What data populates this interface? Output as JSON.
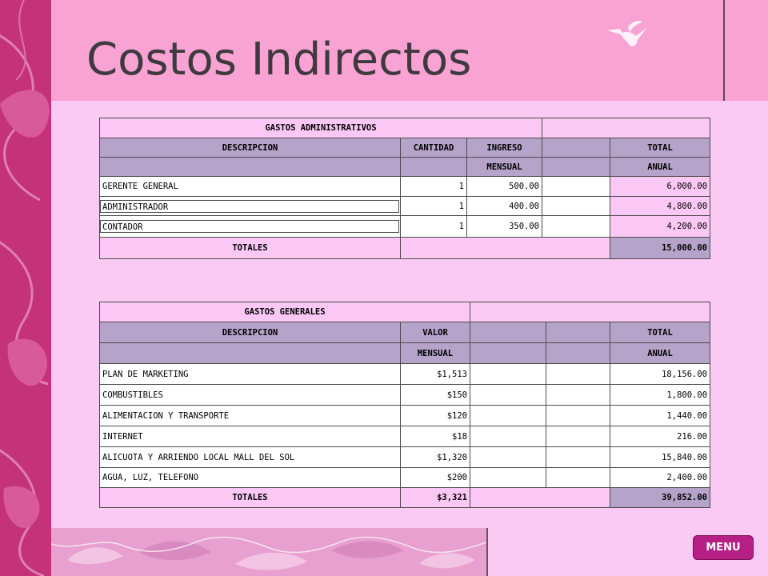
{
  "title": "Costos Indirectos",
  "admin": {
    "section_title": "GASTOS ADMINISTRATIVOS",
    "headers": {
      "descripcion": "DESCRIPCION",
      "cantidad": "CANTIDAD",
      "ingreso_1": "INGRESO",
      "ingreso_2": "MENSUAL",
      "total_1": "TOTAL",
      "total_2": "ANUAL"
    },
    "rows": [
      {
        "descripcion": "GERENTE GENERAL",
        "cantidad": "1",
        "ingreso": "500.00",
        "total": "6,000.00"
      },
      {
        "descripcion": "ADMINISTRADOR",
        "cantidad": "1",
        "ingreso": "400.00",
        "total": "4,800.00"
      },
      {
        "descripcion": "CONTADOR",
        "cantidad": "1",
        "ingreso": "350.00",
        "total": "4,200.00"
      }
    ],
    "totals_label": "TOTALES",
    "totals_total": "15,000.00"
  },
  "generales": {
    "section_title": "GASTOS GENERALES",
    "headers": {
      "descripcion": "DESCRIPCION",
      "valor_1": "VALOR",
      "valor_2": "MENSUAL",
      "total_1": "TOTAL",
      "total_2": "ANUAL"
    },
    "rows": [
      {
        "descripcion": "PLAN DE MARKETING",
        "valor": "$1,513",
        "total": "18,156.00"
      },
      {
        "descripcion": "COMBUSTIBLES",
        "valor": "$150",
        "total": "1,800.00"
      },
      {
        "descripcion": "ALIMENTACION Y TRANSPORTE",
        "valor": "$120",
        "total": "1,440.00"
      },
      {
        "descripcion": "INTERNET",
        "valor": "$18",
        "total": "216.00"
      },
      {
        "descripcion": "ALICUOTA Y ARRIENDO LOCAL MALL DEL SOL",
        "valor": "$1,320",
        "total": "15,840.00"
      },
      {
        "descripcion": "AGUA, LUZ, TELEFONO",
        "valor": "$200",
        "total": "2,400.00"
      }
    ],
    "totals_label": "TOTALES",
    "totals_valor": "$3,321",
    "totals_total": "39,852.00"
  },
  "menu_label": "MENU",
  "colors": {
    "header_pink": "#f8a3d3",
    "content_pink": "#fbcaf4",
    "strip_magenta": "#c4327a",
    "table_header_lavender": "#b5a3ca",
    "menu_button": "#b51f86"
  },
  "icons": {
    "bird": "hummingbird-icon",
    "left_decor": "feather-swirl-decoration",
    "bottom_decor": "feather-pattern-decoration"
  }
}
